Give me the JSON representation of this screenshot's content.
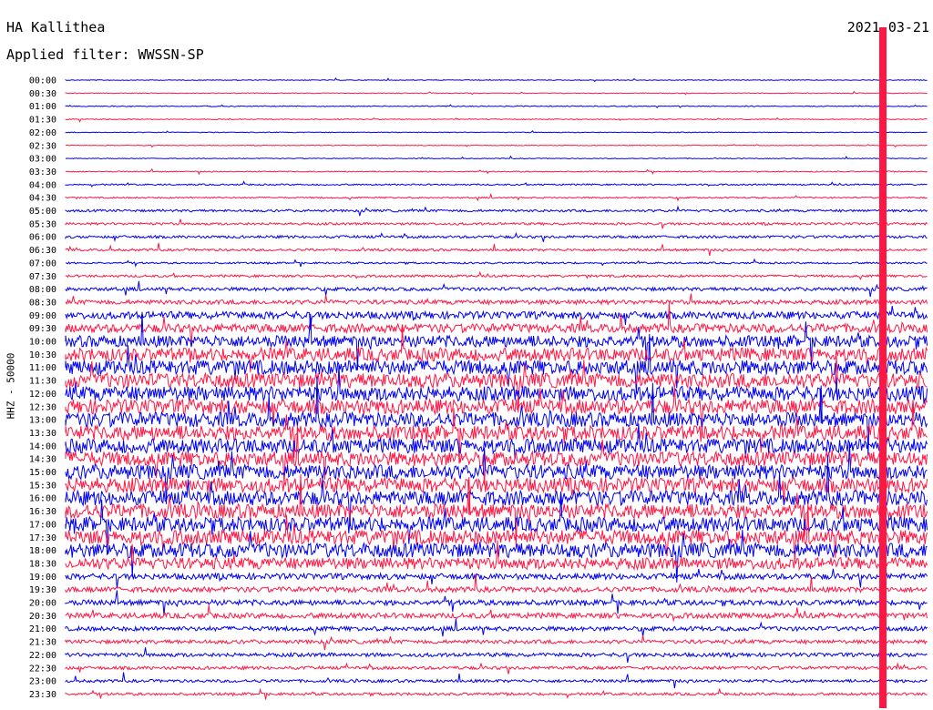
{
  "header": {
    "station": "HA Kallithea",
    "filter": "Applied filter: WWSSN-SP",
    "date": "2021-03-21"
  },
  "chart_data": {
    "type": "line",
    "title": "HA Kallithea",
    "ylabel": "HHZ - 50000",
    "row_labels": [
      "00:00",
      "00:30",
      "01:00",
      "01:30",
      "02:00",
      "02:30",
      "03:00",
      "03:30",
      "04:00",
      "04:30",
      "05:00",
      "05:30",
      "06:00",
      "06:30",
      "07:00",
      "07:30",
      "08:00",
      "08:30",
      "09:00",
      "09:30",
      "10:00",
      "10:30",
      "11:00",
      "11:30",
      "12:00",
      "12:30",
      "13:00",
      "13:30",
      "14:00",
      "14:30",
      "15:00",
      "15:30",
      "16:00",
      "16:30",
      "17:00",
      "17:30",
      "18:00",
      "18:30",
      "19:00",
      "19:30",
      "20:00",
      "20:30",
      "21:00",
      "21:30",
      "22:00",
      "22:30",
      "23:00",
      "23:30"
    ],
    "trace_colors": [
      "#0000ee",
      "#ff1744"
    ],
    "relative_activity": [
      0.25,
      0.25,
      0.3,
      0.3,
      0.25,
      0.25,
      0.25,
      0.35,
      0.5,
      0.5,
      0.8,
      0.8,
      0.9,
      0.8,
      0.6,
      0.8,
      1.2,
      1.5,
      2.5,
      3,
      4,
      4.5,
      5,
      5,
      5,
      5,
      5,
      5,
      5,
      5,
      5,
      5,
      5,
      5,
      5,
      5,
      5,
      4,
      2,
      1.8,
      1.8,
      1.8,
      1.5,
      1.3,
      1.3,
      1.1,
      1,
      0.9
    ]
  }
}
